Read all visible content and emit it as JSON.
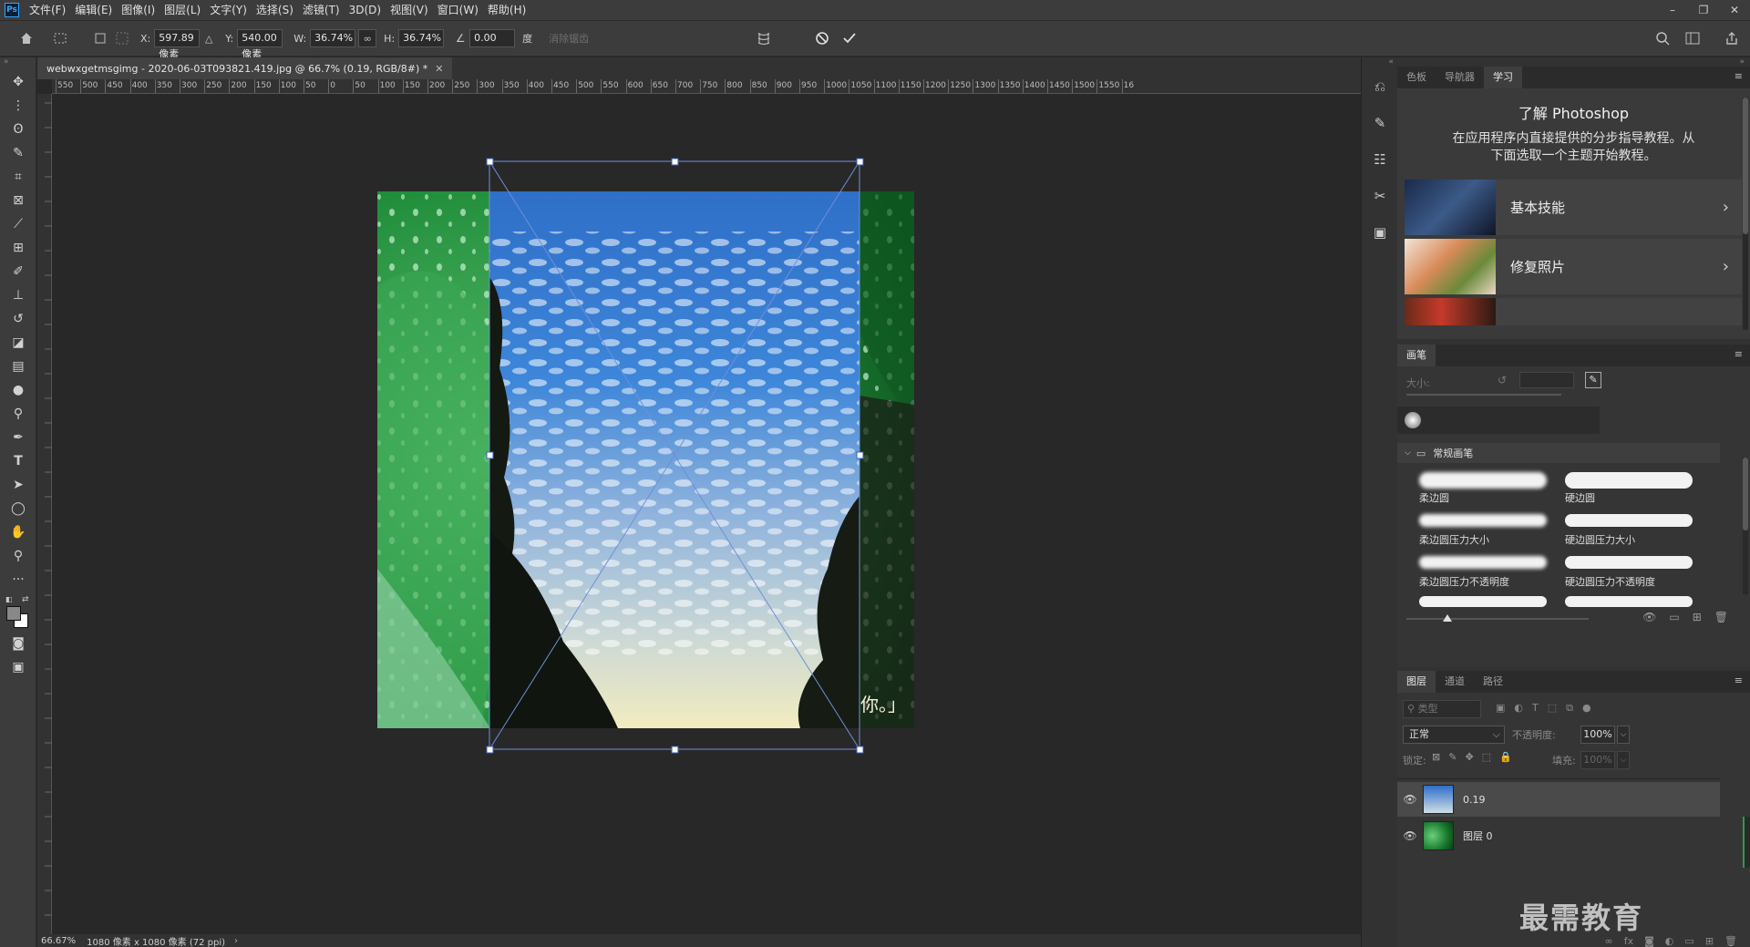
{
  "app": {
    "logo": "Ps"
  },
  "menu": [
    "文件(F)",
    "编辑(E)",
    "图像(I)",
    "图层(L)",
    "文字(Y)",
    "选择(S)",
    "滤镜(T)",
    "3D(D)",
    "视图(V)",
    "窗口(W)",
    "帮助(H)"
  ],
  "window_controls": {
    "minimize": "–",
    "restore": "❐",
    "close": "✕"
  },
  "options": {
    "x_label": "X:",
    "x_value": "597.89 像素",
    "y_label": "Y:",
    "y_value": "540.00 像素",
    "w_label": "W:",
    "w_value": "36.74%",
    "h_label": "H:",
    "h_value": "36.74%",
    "angle_value": "0.00",
    "angle_unit": "度",
    "interp": "消除锯齿"
  },
  "document": {
    "tab_title": "webwxgetmsgimg - 2020-06-03T093821.419.jpg @ 66.7% (0.19, RGB/8#) *",
    "ruler_labels": [
      "550",
      "500",
      "450",
      "400",
      "350",
      "300",
      "250",
      "200",
      "150",
      "100",
      "50",
      "0",
      "50",
      "100",
      "150",
      "200",
      "250",
      "300",
      "350",
      "400",
      "450",
      "500",
      "550",
      "600",
      "650",
      "700",
      "750",
      "800",
      "850",
      "900",
      "950",
      "1000",
      "1050",
      "1100",
      "1150",
      "1200",
      "1250",
      "1300",
      "1350",
      "1400",
      "1450",
      "1500",
      "1550",
      "16"
    ],
    "status_zoom": "66.67%",
    "status_info": "1080 像素 x 1080 像素 (72 ppi)",
    "canvas_caption": "你。」"
  },
  "learn_panel": {
    "tabs": [
      "色板",
      "导航器",
      "学习"
    ],
    "active_tab": "学习",
    "title": "了解 Photoshop",
    "desc_line1": "在应用程序内直接提供的分步指导教程。从",
    "desc_line2": "下面选取一个主题开始教程。",
    "cards": [
      "基本技能",
      "修复照片"
    ]
  },
  "brush_panel": {
    "tab": "画笔",
    "size_label": "大小:",
    "group": "常规画笔",
    "brushes": [
      "柔边圆",
      "硬边圆",
      "柔边圆压力大小",
      "硬边圆压力大小",
      "柔边圆压力不透明度",
      "硬边圆压力不透明度"
    ]
  },
  "layers_panel": {
    "tabs": [
      "图层",
      "通道",
      "路径"
    ],
    "active_tab": "图层",
    "search_placeholder": "类型",
    "blend_mode": "正常",
    "opacity_label": "不透明度:",
    "opacity_value": "100%",
    "lock_label": "锁定:",
    "fill_label": "填充:",
    "fill_value": "100%",
    "layers": [
      {
        "name": "0.19"
      },
      {
        "name": "图层 0"
      }
    ]
  },
  "watermark": "最需教育",
  "colors": {
    "accent": "#31a8ff",
    "panel": "#323232",
    "bar": "#3c3c3c"
  }
}
